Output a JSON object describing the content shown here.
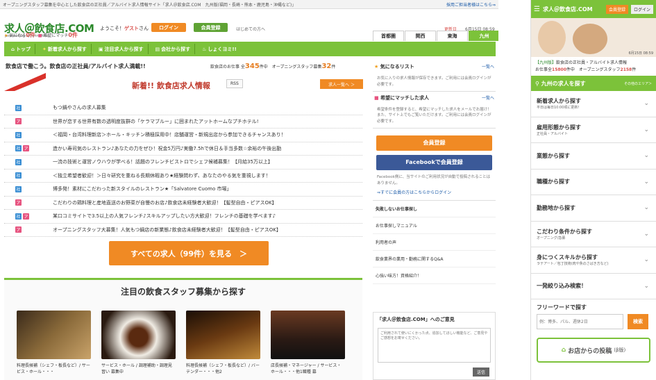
{
  "topbar": {
    "text": "オープニングスタッフ募集を中心とした飲食店の正社員／アルバイト求人情報サイト「求人＠飲食店.COM　九州版(福岡・長崎・熊本・鹿児島・沖縄など)」",
    "right_link": "採用ご担当者様はこちら⇒"
  },
  "header": {
    "logo": "求人＠飲食店.COM",
    "logo_sub": "powered by synchro-food",
    "welcome_pre": "ようこそ！",
    "guest": "ゲスト",
    "welcome_post": "さん",
    "login": "ログイン",
    "register": "会員登録",
    "first_time": "はじめての方へ",
    "updated": "更新日",
    "date": "6月15日 08:59",
    "fav_label": "気になる",
    "fav_count": "0件",
    "match_label": "希望にマッチ",
    "match_count": "0件",
    "regions": [
      "首都圏",
      "関西",
      "東海",
      "九州"
    ]
  },
  "nav": [
    "トップ",
    "新着求人から探す",
    "注目求人から探す",
    "会社から探す",
    "しょくヨミ!!"
  ],
  "tagline": "飲食店で働こう。飲食店の正社員/アルバイト求人満載!!",
  "counts": {
    "pre": "飲食店のお仕事 全",
    "total": "345",
    "mid": "件中　オープニングスタッフ募集",
    "opening": "32",
    "post": "件"
  },
  "new_section": {
    "ribbon": "NEW!",
    "title": "新着!! 飲食店求人情報",
    "rss": "RSS",
    "list_btn": "求人一覧へ ＞"
  },
  "jobs": [
    {
      "tags": [
        "社"
      ],
      "title": "もつ鍋やさんの求人募集"
    },
    {
      "tags": [
        "ア"
      ],
      "title": "世界が恋する世界有数の透明度抜群の「ケラマブルー」に囲まれたアットホームなプチホテル!"
    },
    {
      "tags": [
        "社"
      ],
      "title": "＜福岡・台湾料理新店＞ホール・キッチン積極採用中！店舗運営・新規出店から参加できるチャンスあり！"
    },
    {
      "tags": [
        "社",
        "ア"
      ],
      "title": "造かい寿司気のレストラン♪あなたの力をぜひ！祝金5万円♪実働7.5hで休日＆手当多数☆余裕の午後出勤"
    },
    {
      "tags": [
        "社"
      ],
      "title": "一流の技術と運営ノウハウが学べる！話題のフレンチビストロでシェフ候補募集！【月給35万以上】"
    },
    {
      "tags": [
        "社"
      ],
      "title": "＜独立希望者歓迎！＞日々研究を重ねる長期休暇あり★経験問わず、あなたのやる気を重視します！"
    },
    {
      "tags": [
        "社"
      ],
      "title": "博多発！素材にこだわった新スタイルのレストラン★「Salvatore Cuomo 市場」"
    },
    {
      "tags": [
        "ア"
      ],
      "title": "こだわりの鶏料理と産地直送のお野菜が自慢のお店♪飲食店未経験者大歓迎！【髪型自由・ピアスOK】"
    },
    {
      "tags": [
        "社",
        "ア"
      ],
      "title": "某口コミサイトで3.5以上の人気フレンチ♪スキルアップしたい方大歓迎！フレンチの基礎を学べます♪"
    },
    {
      "tags": [
        "ア"
      ],
      "title": "オープニングスタッフ大募集！人気もつ鍋店の新業態♪飲食店未経験者大歓迎！【髪型自由・ピアスOK】"
    }
  ],
  "all_jobs": "すべての求人（99件）を見る　＞",
  "featured": {
    "title": "注目の飲食スタッフ募集から探す",
    "cards": [
      {
        "text": "料理長候補（シェフ・板長など）/ サービス・ホール・・・"
      },
      {
        "text": "サービス・ホール / 調理補助・調理見習い 募集中"
      },
      {
        "text": "料理長候補（シェフ・板長など）/ バーテンダー・・・他2"
      },
      {
        "text": "店長候補・マネージャー / サービス・ホール・・・他1職種 募"
      }
    ]
  },
  "right": {
    "fav_title": "気になるリスト",
    "fav_more": "一覧へ",
    "fav_text": "お気に入りの求人情報が保存できます。ご利用には会員ログインが必要です。",
    "match_title": "希望にマッチした求人",
    "match_more": "一覧へ",
    "match_text": "希望条件を登録すると、希望にマッチした求人をメールでお届け！また、サイト上でもご覧いただけます。ご利用には会員ログインが必要です。",
    "reg_btn": "会員登録",
    "fb_btn": "Facebookで会員登録",
    "fb_note": "Facebook側に、当サイトのご利用状況が自動で投稿されることはありません。",
    "fb_login": "⇒すでに会員の方はこちらからログイン",
    "links_title": "失敗しないお仕事探し",
    "links": [
      "お仕事探しマニュアル",
      "利用者の声",
      "飲食業界の業用・勤務に関するQ&A",
      "心強い味方！資格紹介！"
    ],
    "opinion_title": "「求人＠飲食店.COM」へのご意見",
    "opinion_placeholder": "ご利用されて使いにくかった点、追加してほしい機能など、ご意見やご感想をお寄せください。",
    "send": "送信"
  },
  "side": {
    "logo": "求人＠飲食店.COM",
    "reg": "会員登録",
    "login": "ログイン",
    "hero_date": "6月15日 08:59",
    "info_region": "【九州版】",
    "info_text": "飲食店の正社員・アルバイト求人情報",
    "info_count_pre": "お仕事全",
    "info_count": "15800",
    "info_mid": "件中　オープニングスタッフ",
    "info_count2": "2158",
    "info_post": "件",
    "head": "九州の求人を探す",
    "head_right": "その他のエリア＞",
    "menu": [
      {
        "t": "新着求人から探す",
        "s": "平日は毎日10:00頃に更新！"
      },
      {
        "t": "雇用形態から探す",
        "s": "正社員・アルバイト"
      },
      {
        "t": "業態から探す",
        "s": ""
      },
      {
        "t": "職種から探す",
        "s": ""
      },
      {
        "t": "勤務地から探す",
        "s": ""
      },
      {
        "t": "こだわり条件から探す",
        "s": "オープニング/急募"
      },
      {
        "t": "身につくスキルから探す",
        "s": "ラテアート／包丁技術(肉や魚のさばき方など)"
      },
      {
        "t": "一発絞り込み検索！",
        "s": ""
      }
    ],
    "free_title": "フリーワードで探す",
    "free_placeholder": "例：博多、パル、週休2日",
    "free_btn": "検索",
    "post": "お店からの投稿",
    "post_sub": "(β版)"
  }
}
